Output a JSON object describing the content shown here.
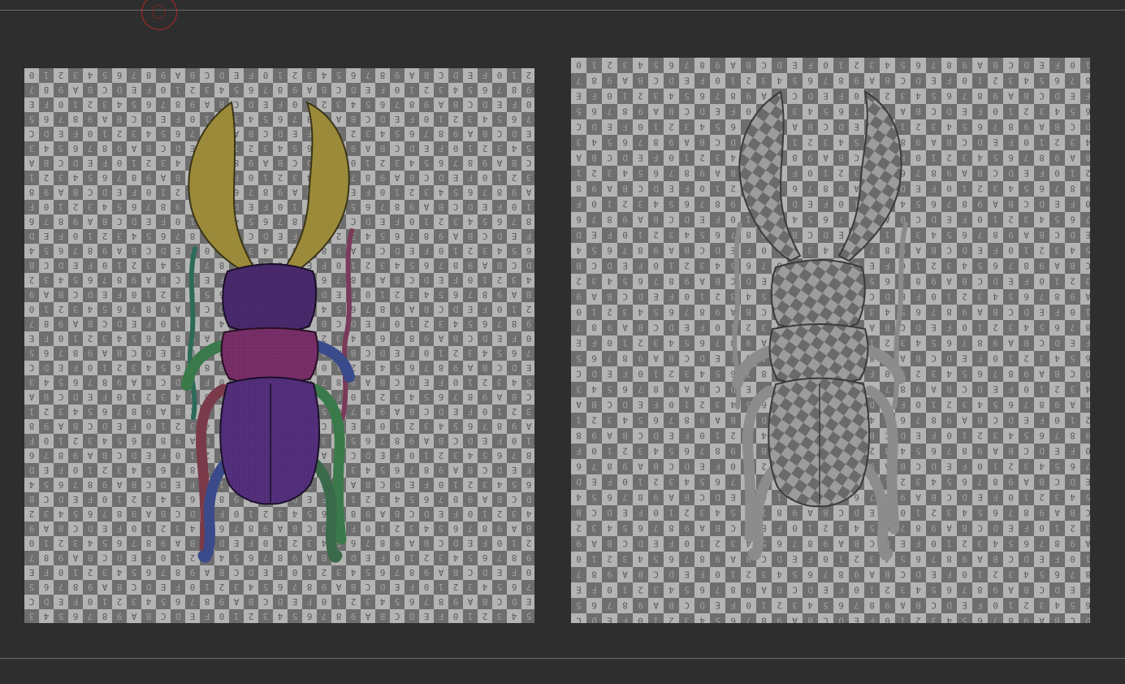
{
  "viewport": {
    "background": "#2e2e2e",
    "divider_color": "#6a6a6a",
    "cursor_ring_color": "#b42828"
  },
  "uv_checker": {
    "glyphs": [
      "0",
      "1",
      "2",
      "3",
      "4",
      "5",
      "6",
      "7",
      "8",
      "9",
      "A",
      "B",
      "C",
      "D",
      "E",
      "F"
    ],
    "light_color": "#b4b4b4",
    "dark_color": "#6e6e6e",
    "glyph_color_on_light": "#5a5a5a",
    "glyph_color_on_dark": "#a0a0a0"
  },
  "panels": [
    {
      "name": "polygroup-view",
      "beetle_style": "polygroups",
      "colors": {
        "mandibles": "#9a8a3a",
        "head": "#4a2a6e",
        "thorax": "#7a2f6a",
        "elytra": "#55307e",
        "legs_front": "#3a7a4a",
        "legs_mid": "#7a3a4a",
        "legs_back": "#3a4a8a",
        "antenna": "#2e6a5a"
      }
    },
    {
      "name": "uv-textured-view",
      "beetle_style": "checker",
      "colors": {
        "body": "#9a9a9a",
        "outline": "#3a3a3a"
      }
    }
  ]
}
